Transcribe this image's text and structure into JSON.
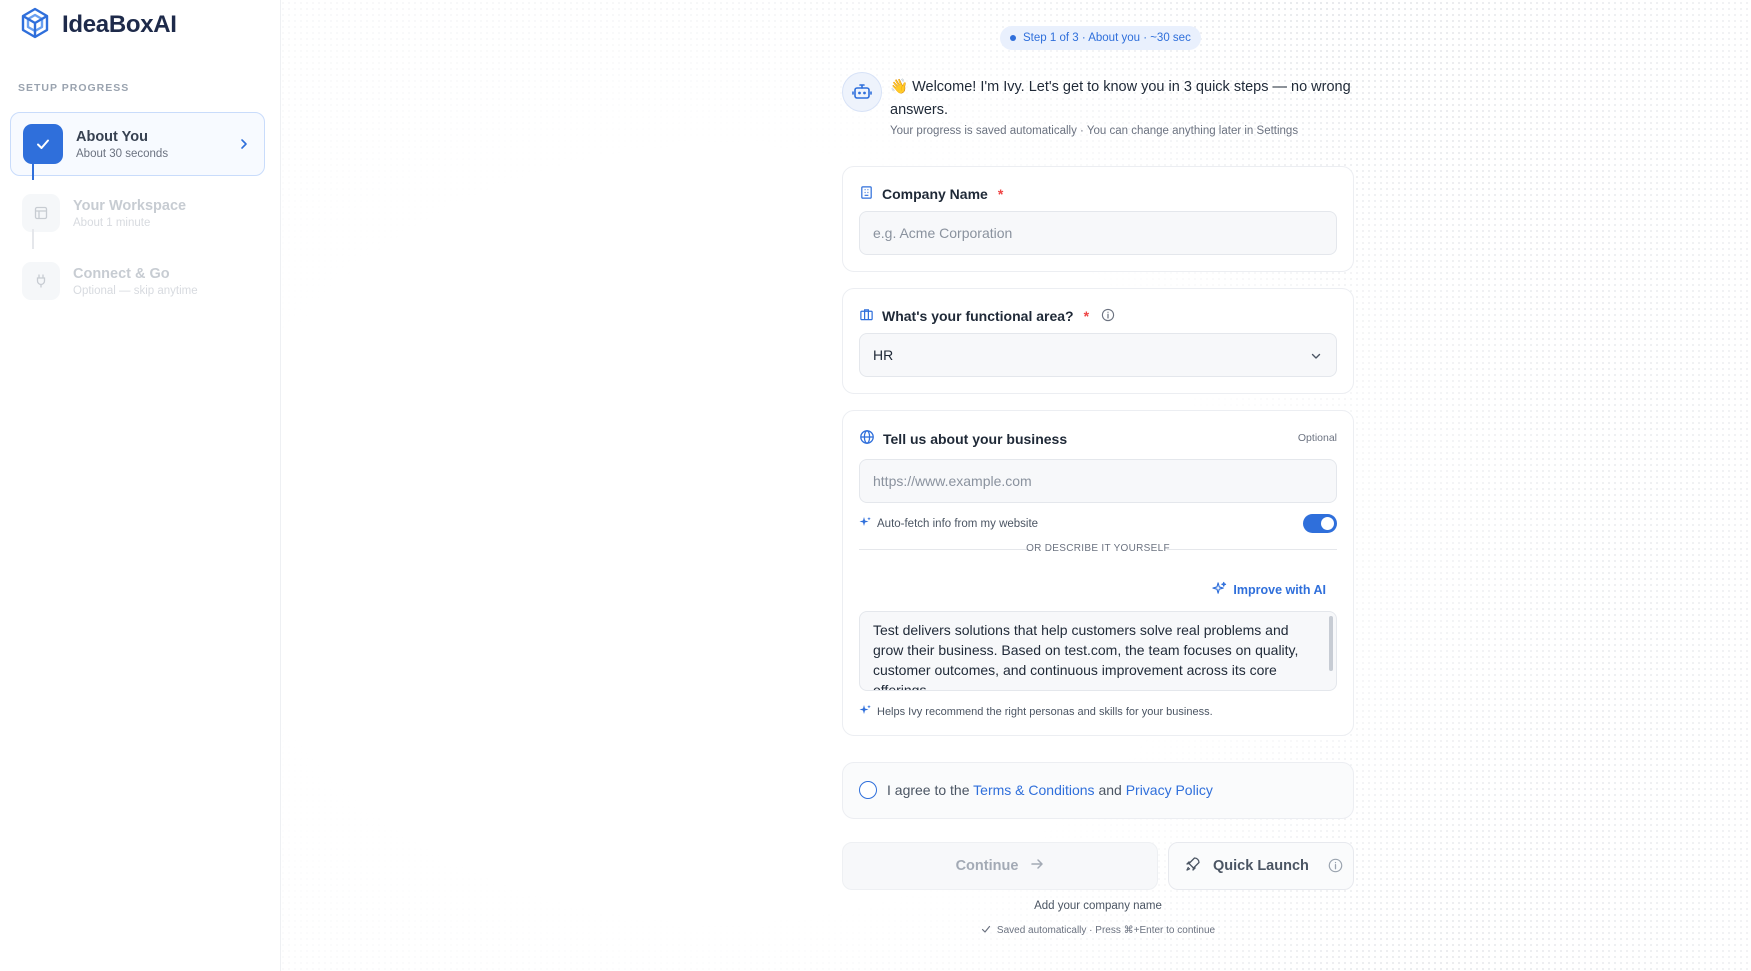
{
  "brand": {
    "name": "IdeaBoxAI"
  },
  "sidebar": {
    "heading": "SETUP PROGRESS",
    "steps": [
      {
        "title": "About You",
        "subtitle": "About 30 seconds",
        "state": "active"
      },
      {
        "title": "Your Workspace",
        "subtitle": "About 1 minute",
        "state": "pending"
      },
      {
        "title": "Connect & Go",
        "subtitle": "Optional — skip anytime",
        "state": "pending"
      }
    ]
  },
  "header": {
    "step_pill": "Step 1 of 3 · About you · ~30 sec"
  },
  "welcome": {
    "emoji": "👋",
    "message": "Welcome! I'm Ivy. Let's get to know you in 3 quick steps — no wrong answers.",
    "subtext": "Your progress is saved automatically · You can change anything later in Settings"
  },
  "company": {
    "label": "Company Name",
    "required_mark": "*",
    "value": "",
    "placeholder": "e.g. Acme Corporation"
  },
  "functional_area": {
    "label": "What's your functional area?",
    "required_mark": "*",
    "selected": "HR"
  },
  "business": {
    "label": "Tell us about your business",
    "optional_label": "Optional",
    "url_value": "",
    "url_placeholder": "https://www.example.com",
    "autofetch_label": "Auto-fetch info from my website",
    "autofetch_enabled": true,
    "divider_text": "OR DESCRIBE IT YOURSELF",
    "improve_label": "Improve with AI",
    "description": "Test delivers solutions that help customers solve real problems and grow their business. Based on test.com, the team focuses on quality, customer outcomes, and continuous improvement across its core offerings.",
    "helper": "Helps Ivy recommend the right personas and skills for your business."
  },
  "agreement": {
    "prefix": "I agree to the",
    "terms_link": "Terms & Conditions",
    "conjunction": "and",
    "privacy_link": "Privacy Policy"
  },
  "actions": {
    "continue_label": "Continue",
    "quick_launch_label": "Quick Launch",
    "hint": "Add your company name",
    "saved_note": "Saved automatically · Press ⌘+Enter to continue"
  },
  "colors": {
    "accent": "#2f6fdb",
    "required": "#ef4444",
    "brand_dark": "#1e2a4a"
  },
  "icons": {
    "brand": "cube-logo-icon",
    "step_done": "check-icon",
    "workspace": "layout-icon",
    "connect": "plug-icon",
    "avatar": "robot-icon",
    "company": "building-icon",
    "area": "briefcase-icon",
    "business": "globe-icon",
    "sparkle": "sparkle-icon",
    "rocket": "rocket-icon",
    "info": "info-icon"
  }
}
